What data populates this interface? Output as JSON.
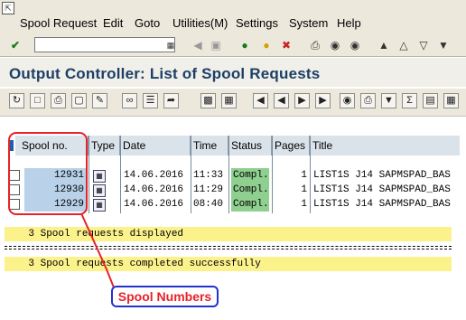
{
  "menu": {
    "items": [
      {
        "label": "Spool Request"
      },
      {
        "label": "Edit"
      },
      {
        "label": "Goto"
      },
      {
        "label": "Utilities(M)"
      },
      {
        "label": "Settings"
      },
      {
        "label": "System"
      },
      {
        "label": "Help"
      }
    ]
  },
  "page": {
    "title": "Output Controller: List of Spool Requests"
  },
  "table": {
    "columns": [
      "Spool no.",
      "Type",
      "Date",
      "Time",
      "Status",
      "Pages",
      "Title"
    ],
    "rows": [
      {
        "spool_no": "12931",
        "date": "14.06.2016",
        "time": "11:33",
        "status": "Compl.",
        "pages": "1",
        "title": "LIST1S J14 SAPMSPAD_BAS"
      },
      {
        "spool_no": "12930",
        "date": "14.06.2016",
        "time": "11:29",
        "status": "Compl.",
        "pages": "1",
        "title": "LIST1S J14 SAPMSPAD_BAS"
      },
      {
        "spool_no": "12929",
        "date": "14.06.2016",
        "time": "08:40",
        "status": "Compl.",
        "pages": "1",
        "title": "LIST1S J14 SAPMSPAD_BAS"
      }
    ]
  },
  "messages": {
    "line1": "    3 Spool requests displayed",
    "line2": "    3 Spool requests completed successfully"
  },
  "annotation": {
    "label": "Spool Numbers"
  },
  "colors": {
    "title": "#1d3f66",
    "status_ok": "#8fcf8f",
    "spool_highlight": "#b9d2ea",
    "message_bg": "#fbf28c",
    "annotation_red": "#e8222a",
    "annotation_blue": "#2233cc"
  }
}
